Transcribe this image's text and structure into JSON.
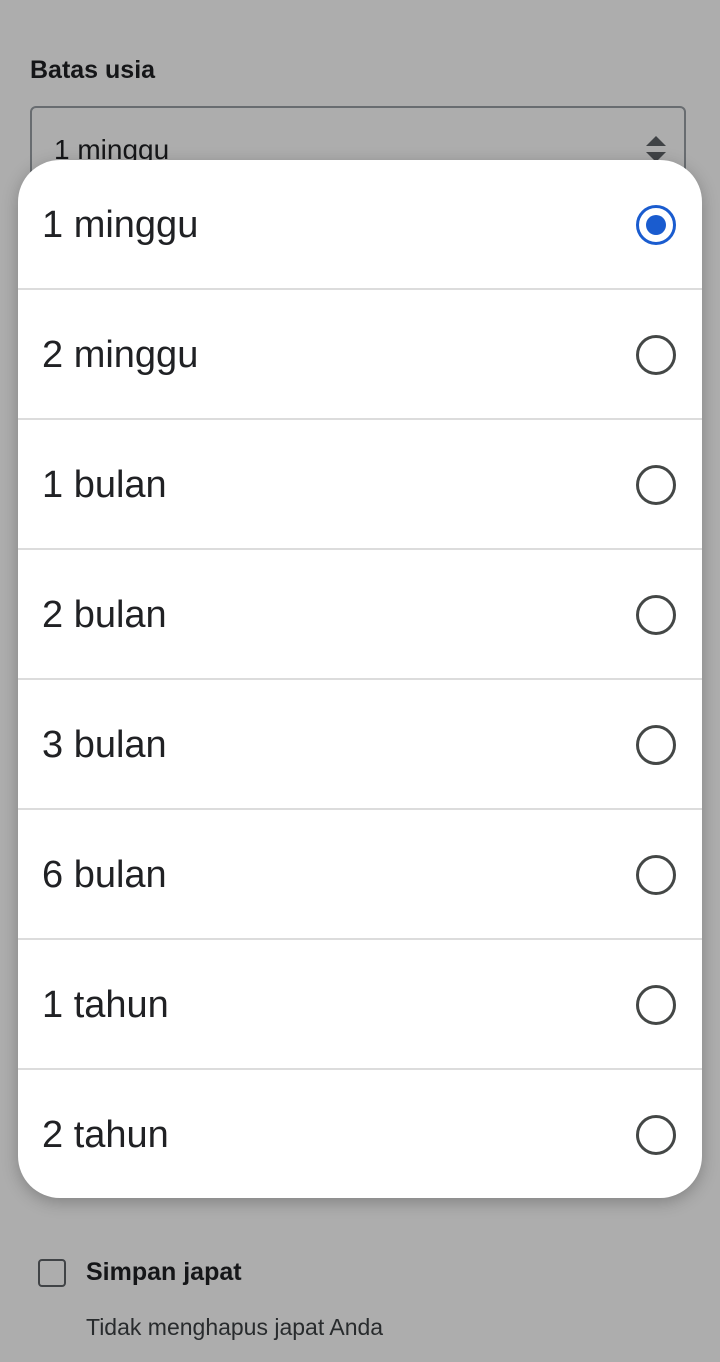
{
  "form": {
    "age_limit_label": "Batas usia",
    "age_limit_value": "1 minggu",
    "keep_favorites_label": "Simpan japat",
    "keep_favorites_desc": "Tidak menghapus japat Anda",
    "keep_favorites_checked": false
  },
  "dialog": {
    "selected_index": 0,
    "options": [
      {
        "label": "1 minggu"
      },
      {
        "label": "2 minggu"
      },
      {
        "label": "1 bulan"
      },
      {
        "label": "2 bulan"
      },
      {
        "label": "3 bulan"
      },
      {
        "label": "6 bulan"
      },
      {
        "label": "1 tahun"
      },
      {
        "label": "2 tahun"
      }
    ]
  },
  "colors": {
    "accent": "#1a5ccf",
    "scrim": "rgba(0,0,0,0.32)",
    "divider": "#dcdcdc"
  },
  "icons": {
    "spinner": "up-down-arrows-icon",
    "radio_checked": "radio-checked-icon",
    "radio_unchecked": "radio-unchecked-icon"
  }
}
